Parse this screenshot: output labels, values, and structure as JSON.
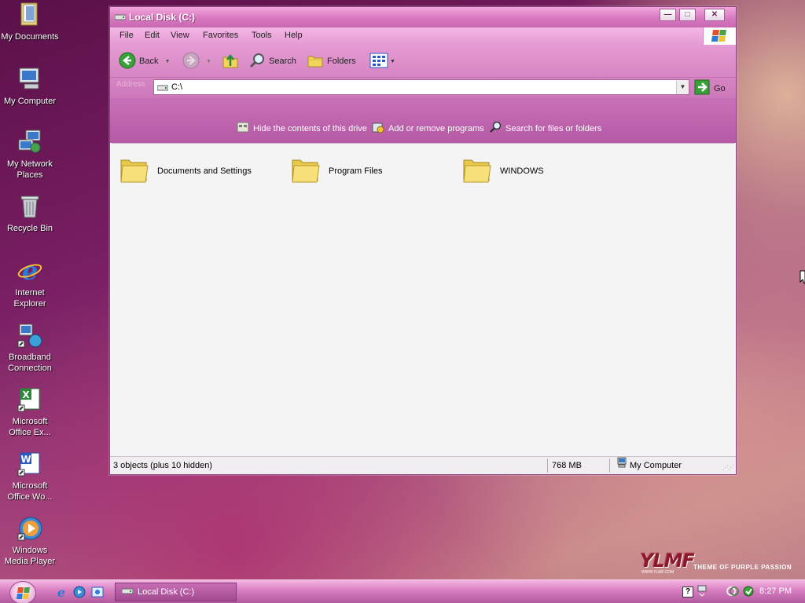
{
  "desktop": {
    "icons": [
      {
        "label": "My Documents",
        "icon": "my-documents-icon"
      },
      {
        "label": "My Computer",
        "icon": "my-computer-icon"
      },
      {
        "label": "My Network Places",
        "icon": "network-places-icon"
      },
      {
        "label": "Recycle Bin",
        "icon": "recycle-bin-icon"
      },
      {
        "label": "Internet Explorer",
        "icon": "internet-explorer-icon"
      },
      {
        "label": "Broadband Connection",
        "icon": "broadband-connection-icon"
      },
      {
        "label": "Microsoft Office Ex...",
        "icon": "excel-icon"
      },
      {
        "label": "Microsoft Office Wo...",
        "icon": "word-icon"
      },
      {
        "label": "Windows Media Player",
        "icon": "media-player-icon"
      }
    ]
  },
  "window": {
    "title": "Local Disk (C:)",
    "controls": {
      "minimize": "—",
      "maximize": "□",
      "close": "✕"
    },
    "menu": [
      "File",
      "Edit",
      "View",
      "Favorites",
      "Tools",
      "Help"
    ],
    "toolbar": {
      "back": "Back",
      "search": "Search",
      "folders": "Folders"
    },
    "address": {
      "label": "Address",
      "value": "C:\\",
      "go": "Go"
    },
    "tasks": [
      {
        "label": "Hide the contents of this drive",
        "icon": "hide-contents-icon"
      },
      {
        "label": "Add or remove programs",
        "icon": "add-remove-programs-icon"
      },
      {
        "label": "Search for files or folders",
        "icon": "search-icon"
      }
    ],
    "items": [
      {
        "name": "Documents and Settings"
      },
      {
        "name": "Program Files"
      },
      {
        "name": "WINDOWS"
      }
    ],
    "status": {
      "objects": "3 objects (plus 10 hidden)",
      "size": "768 MB",
      "location": "My Computer"
    }
  },
  "taskbar": {
    "active_task": "Local Disk (C:)",
    "clock": "8:27 PM"
  },
  "branding": {
    "logo_text": "YLMF",
    "tagline": "THEME OF PURPLE PASSION",
    "url": "WWW.YLMF.COM"
  },
  "colors": {
    "accent": "#d778bf",
    "titlebar_start": "#f2a6dc",
    "taskpane": "#b65aa6"
  }
}
